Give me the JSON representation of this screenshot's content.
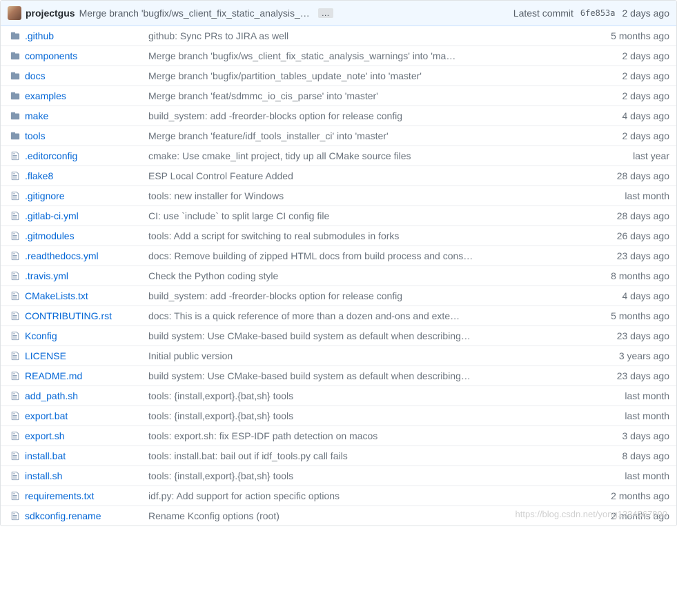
{
  "header": {
    "author": "projectgus",
    "commit_message": "Merge branch 'bugfix/ws_client_fix_static_analysis_warnings' into 'ma…",
    "latest_label": "Latest commit",
    "sha": "6fe853a",
    "age": "2 days ago"
  },
  "files": [
    {
      "type": "dir",
      "name": ".github",
      "message": "github: Sync PRs to JIRA as well",
      "age": "5 months ago"
    },
    {
      "type": "dir",
      "name": "components",
      "message": "Merge branch 'bugfix/ws_client_fix_static_analysis_warnings' into 'ma…",
      "age": "2 days ago"
    },
    {
      "type": "dir",
      "name": "docs",
      "message": "Merge branch 'bugfix/partition_tables_update_note' into 'master'",
      "age": "2 days ago"
    },
    {
      "type": "dir",
      "name": "examples",
      "message": "Merge branch 'feat/sdmmc_io_cis_parse' into 'master'",
      "age": "2 days ago"
    },
    {
      "type": "dir",
      "name": "make",
      "message": "build_system: add -freorder-blocks option for release config",
      "age": "4 days ago"
    },
    {
      "type": "dir",
      "name": "tools",
      "message": "Merge branch 'feature/idf_tools_installer_ci' into 'master'",
      "age": "2 days ago"
    },
    {
      "type": "file",
      "name": ".editorconfig",
      "message": "cmake: Use cmake_lint project, tidy up all CMake source files",
      "age": "last year"
    },
    {
      "type": "file",
      "name": ".flake8",
      "message": "ESP Local Control Feature Added",
      "age": "28 days ago"
    },
    {
      "type": "file",
      "name": ".gitignore",
      "message": "tools: new installer for Windows",
      "age": "last month"
    },
    {
      "type": "file",
      "name": ".gitlab-ci.yml",
      "message": "CI: use `include` to split large CI config file",
      "age": "28 days ago"
    },
    {
      "type": "file",
      "name": ".gitmodules",
      "message": "tools: Add a script for switching to real submodules in forks",
      "age": "26 days ago"
    },
    {
      "type": "file",
      "name": ".readthedocs.yml",
      "message": "docs: Remove building of zipped HTML docs from build process and cons…",
      "age": "23 days ago"
    },
    {
      "type": "file",
      "name": ".travis.yml",
      "message": "Check the Python coding style",
      "age": "8 months ago"
    },
    {
      "type": "file",
      "name": "CMakeLists.txt",
      "message": "build_system: add -freorder-blocks option for release config",
      "age": "4 days ago"
    },
    {
      "type": "file",
      "name": "CONTRIBUTING.rst",
      "message": "docs: This is a quick reference of more than a dozen and-ons and exte…",
      "age": "5 months ago"
    },
    {
      "type": "file",
      "name": "Kconfig",
      "message": "build system: Use CMake-based build system as default when describing…",
      "age": "23 days ago"
    },
    {
      "type": "file",
      "name": "LICENSE",
      "message": "Initial public version",
      "age": "3 years ago"
    },
    {
      "type": "file",
      "name": "README.md",
      "message": "build system: Use CMake-based build system as default when describing…",
      "age": "23 days ago"
    },
    {
      "type": "file",
      "name": "add_path.sh",
      "message": "tools: {install,export}.{bat,sh} tools",
      "age": "last month"
    },
    {
      "type": "file",
      "name": "export.bat",
      "message": "tools: {install,export}.{bat,sh} tools",
      "age": "last month"
    },
    {
      "type": "file",
      "name": "export.sh",
      "message": "tools: export.sh: fix ESP-IDF path detection on macos",
      "age": "3 days ago"
    },
    {
      "type": "file",
      "name": "install.bat",
      "message": "tools: install.bat: bail out if idf_tools.py call fails",
      "age": "8 days ago"
    },
    {
      "type": "file",
      "name": "install.sh",
      "message": "tools: {install,export}.{bat,sh} tools",
      "age": "last month"
    },
    {
      "type": "file",
      "name": "requirements.txt",
      "message": "idf.py: Add support for action specific options",
      "age": "2 months ago"
    },
    {
      "type": "file",
      "name": "sdkconfig.rename",
      "message": "Rename Kconfig options (root)",
      "age": "2 months ago"
    }
  ],
  "watermark": "https://blog.csdn.net/yong1234567890"
}
